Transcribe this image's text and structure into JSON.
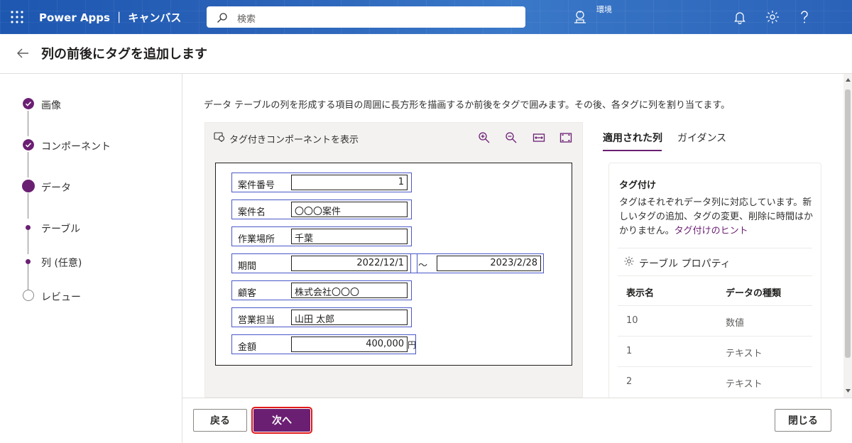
{
  "app": {
    "title": "Power Apps ｜ キャンバス",
    "env_label": "環境"
  },
  "search": {
    "placeholder": "検索"
  },
  "header": {
    "title": "列の前後にタグを追加します"
  },
  "steps": [
    {
      "label": "画像",
      "state": "done"
    },
    {
      "label": "コンポーネント",
      "state": "done"
    },
    {
      "label": "データ",
      "state": "current"
    },
    {
      "label": "テーブル",
      "state": "substep"
    },
    {
      "label": "列 (任意)",
      "state": "substep"
    },
    {
      "label": "レビュー",
      "state": "pending"
    }
  ],
  "main": {
    "description": "データ テーブルの列を形成する項目の周囲に長方形を描画するか前後をタグで囲みます。その後、各タグに列を割り当てます。",
    "viewer_title": "タグ付きコンポーネントを表示"
  },
  "document": {
    "rows": [
      {
        "label": "案件番号",
        "value": "1"
      },
      {
        "label": "案件名",
        "value": "〇〇〇案件"
      },
      {
        "label": "作業場所",
        "value": "千葉"
      },
      {
        "label": "期間",
        "value": "2022/12/1",
        "separator": "～",
        "value2": "2023/2/28"
      },
      {
        "label": "顧客",
        "value": "株式会社〇〇〇"
      },
      {
        "label": "営業担当",
        "value": "山田 太郎"
      },
      {
        "label": "金額",
        "value": "400,000",
        "suffix": "円"
      }
    ]
  },
  "panel": {
    "tabs": [
      "適用された列",
      "ガイダンス"
    ],
    "card_title": "タグ付け",
    "card_text": "タグはそれぞれデータ列に対応しています。新しいタグの追加、タグの変更、削除に時間はかかりません。",
    "card_link": "タグ付けのヒント",
    "properties_label": "テーブル プロパティ",
    "table_headers": [
      "表示名",
      "データの種類"
    ],
    "table_rows": [
      [
        "10",
        "数値"
      ],
      [
        "1",
        "テキスト"
      ],
      [
        "2",
        "テキスト"
      ]
    ]
  },
  "footer": {
    "back": "戻る",
    "next": "次へ",
    "close": "閉じる"
  },
  "colors": {
    "accent": "#6b1f73",
    "topbar": "#1f4f9e",
    "tag_border": "#4a58c8",
    "highlight": "#e01a1a"
  }
}
